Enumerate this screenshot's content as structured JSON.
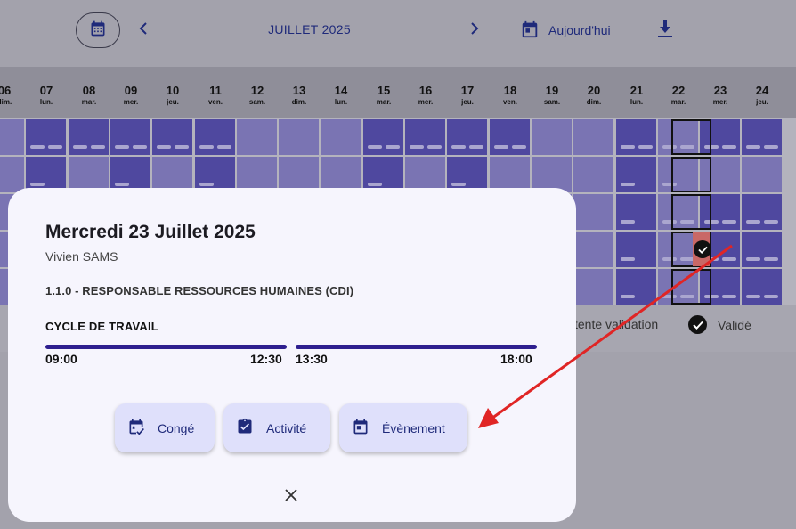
{
  "toolbar": {
    "month": "JUILLET 2025",
    "today_label": "Aujourd'hui",
    "icons": {
      "calendar": "calendar-icon",
      "prev": "chevron-left-icon",
      "next": "chevron-right-icon",
      "today": "calendar-today-icon",
      "download": "download-icon"
    }
  },
  "days": [
    {
      "num": "06",
      "name": "dim."
    },
    {
      "num": "07",
      "name": "lun."
    },
    {
      "num": "08",
      "name": "mar."
    },
    {
      "num": "09",
      "name": "mer."
    },
    {
      "num": "10",
      "name": "jeu."
    },
    {
      "num": "11",
      "name": "ven."
    },
    {
      "num": "12",
      "name": "sam."
    },
    {
      "num": "13",
      "name": "dim."
    },
    {
      "num": "14",
      "name": "lun."
    },
    {
      "num": "15",
      "name": "mar."
    },
    {
      "num": "16",
      "name": "mer."
    },
    {
      "num": "17",
      "name": "jeu."
    },
    {
      "num": "18",
      "name": "ven."
    },
    {
      "num": "19",
      "name": "sam."
    },
    {
      "num": "20",
      "name": "dim."
    },
    {
      "num": "21",
      "name": "lun."
    },
    {
      "num": "22",
      "name": "mar."
    },
    {
      "num": "23",
      "name": "mer."
    },
    {
      "num": "24",
      "name": "jeu."
    }
  ],
  "legend": {
    "pending": "tente validation",
    "valid": "Validé"
  },
  "modal": {
    "date_title": "Mercredi 23 Juillet 2025",
    "employee": "Vivien SAMS",
    "position": "1.1.0 - RESPONSABLE RESSOURCES HUMAINES (CDI)",
    "cycle_title": "CYCLE DE TRAVAIL",
    "cycle": [
      {
        "start": "09:00",
        "end": "12:30"
      },
      {
        "start": "13:30",
        "end": "18:00"
      }
    ],
    "actions": [
      {
        "label": "Congé",
        "icon": "leave-calendar-icon"
      },
      {
        "label": "Activité",
        "icon": "clipboard-check-icon"
      },
      {
        "label": "Évènement",
        "icon": "event-calendar-icon"
      }
    ]
  },
  "colors": {
    "accent": "#2e1f8f",
    "button_bg": "#dfe0fb",
    "cell_dark": "#4f489f",
    "cell_light": "#7a74b3",
    "annotation_arrow": "#e02525"
  }
}
